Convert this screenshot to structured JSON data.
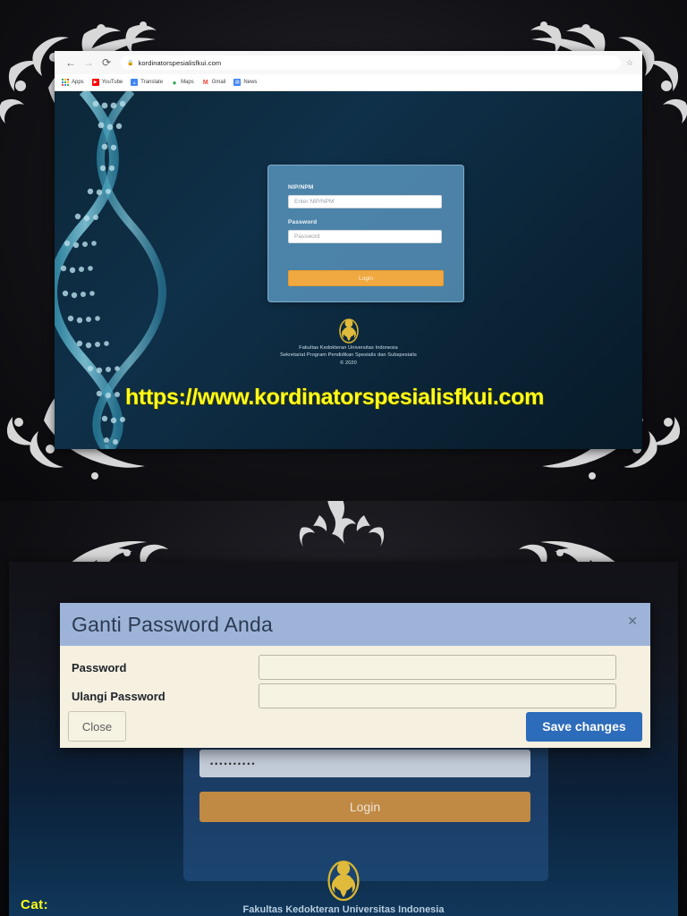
{
  "browser": {
    "back_icon": "back-arrow-icon",
    "forward_icon": "forward-arrow-icon",
    "reload_icon": "reload-icon",
    "lock_icon": "lock-icon",
    "url": "kordinatorspesialisfkui.com",
    "star_icon": "bookmark-star-icon",
    "bookmarks": [
      {
        "label": "Apps",
        "icon": "apps-grid-icon",
        "glyph": "∷",
        "color": "#ffffff"
      },
      {
        "label": "YouTube",
        "icon": "youtube-icon",
        "glyph": "▶",
        "color": "#ff0000"
      },
      {
        "label": "Translate",
        "icon": "translate-icon",
        "glyph": "文",
        "color": "#4285f4"
      },
      {
        "label": "Maps",
        "icon": "maps-pin-icon",
        "glyph": "●",
        "color": "#34a853"
      },
      {
        "label": "Gmail",
        "icon": "gmail-icon",
        "glyph": "M",
        "color": "#ea4335"
      },
      {
        "label": "News",
        "icon": "news-icon",
        "glyph": "▤",
        "color": "#4285f4"
      }
    ]
  },
  "login": {
    "nip_label": "NIP/NPM",
    "nip_placeholder": "Enter NIP/NPM",
    "password_label": "Password",
    "password_placeholder": "Password",
    "login_button": "Login"
  },
  "footer": {
    "logo_icon": "universitas-indonesia-makara-logo",
    "line1": "Fakultas Kedokteran Universitas Indonesia",
    "line2": "Sekretariat Program Pendidikan Spesialis dan Subspesialis",
    "copyright": "© 2020"
  },
  "overlay": {
    "url_text": "https://www.kordinatorspesialisfkui.com",
    "url_color": "#ffff1a"
  },
  "modal": {
    "title": "Ganti Password Anda",
    "close_icon": "close-x-icon",
    "password_label": "Password",
    "repeat_password_label": "Ulangi Password",
    "password_value": "",
    "repeat_password_value": "",
    "close_button": "Close",
    "save_button": "Save changes",
    "save_color": "#2d6cba",
    "header_color": "#9db4d8",
    "body_color": "#f5f0e0"
  },
  "background_page": {
    "password_value": "••••••••••",
    "login_button": "Login",
    "footer_line": "Fakultas Kedokteran Universitas Indonesia",
    "logo_icon": "universitas-indonesia-makara-logo"
  },
  "note": {
    "text": "Cat:",
    "color": "#ffff1a"
  }
}
